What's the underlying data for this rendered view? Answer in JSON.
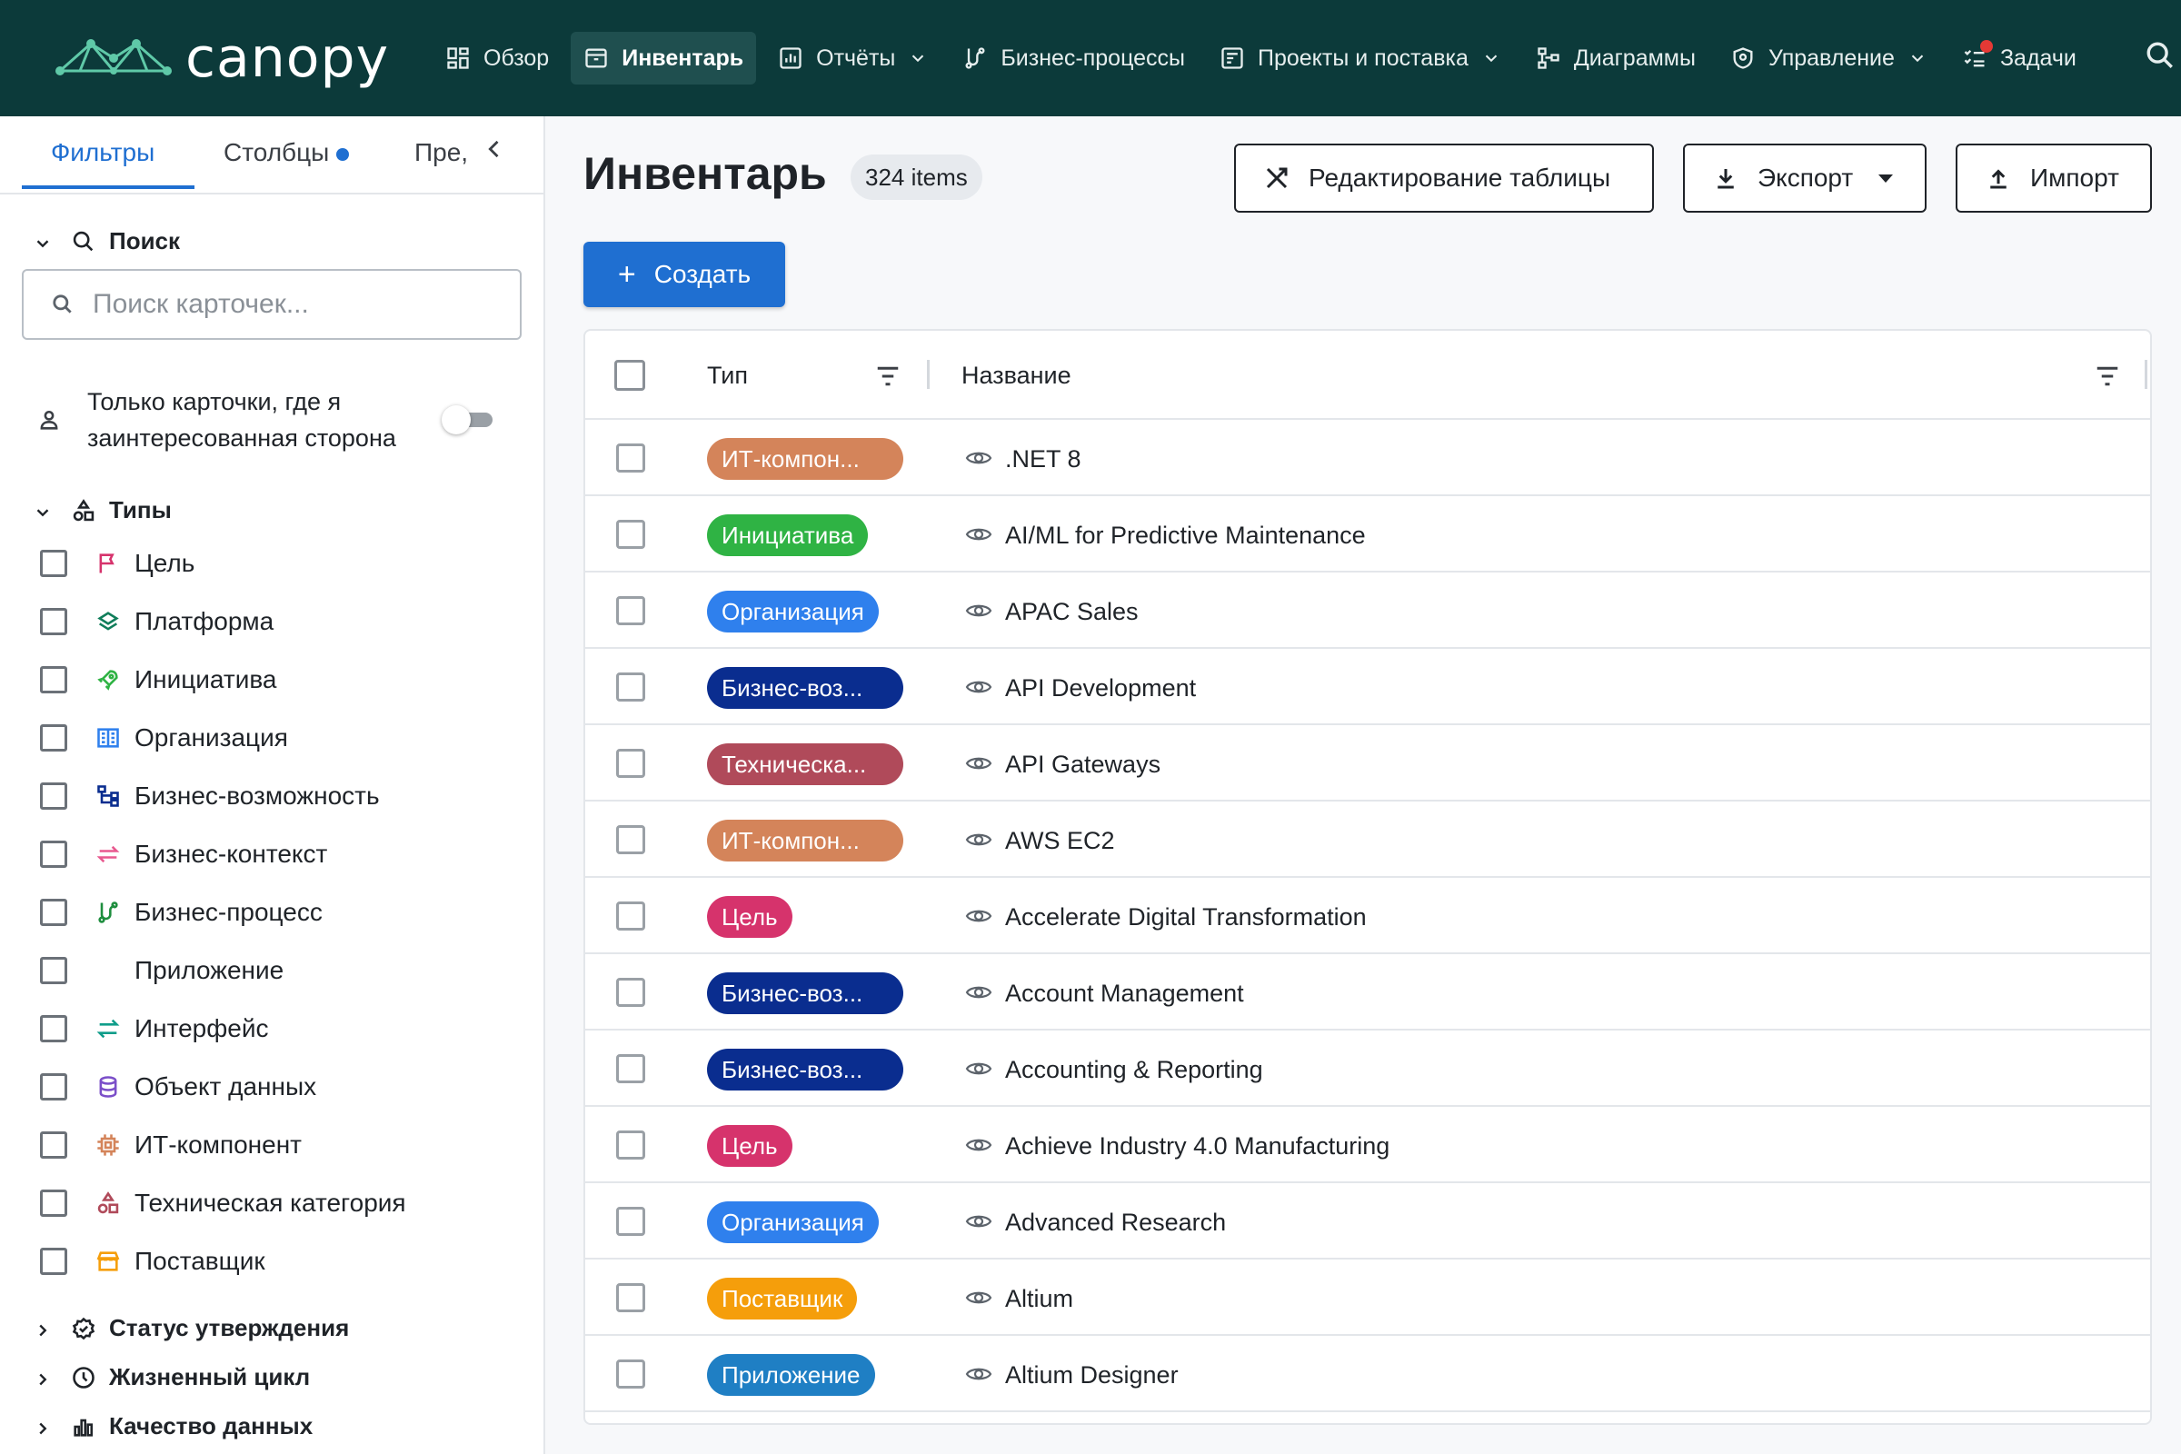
{
  "app": {
    "logo_text": "canopy"
  },
  "nav": {
    "items": [
      {
        "label": "Обзор",
        "icon": "dashboard-icon",
        "active": false,
        "dropdown": false
      },
      {
        "label": "Инвентарь",
        "icon": "inventory-icon",
        "active": true,
        "dropdown": false
      },
      {
        "label": "Отчёты",
        "icon": "reports-icon",
        "active": false,
        "dropdown": true
      },
      {
        "label": "Бизнес-процессы",
        "icon": "process-icon",
        "active": false,
        "dropdown": false
      },
      {
        "label": "Проекты и поставка",
        "icon": "projects-icon",
        "active": false,
        "dropdown": true
      },
      {
        "label": "Диаграммы",
        "icon": "diagram-icon",
        "active": false,
        "dropdown": false
      },
      {
        "label": "Управление",
        "icon": "shield-icon",
        "active": false,
        "dropdown": true
      },
      {
        "label": "Задачи",
        "icon": "tasks-icon",
        "active": false,
        "dropdown": false,
        "notification": true
      }
    ]
  },
  "sidebar": {
    "tabs": {
      "filters": "Фильтры",
      "columns": "Столбцы",
      "presets": "Пре,"
    },
    "search": {
      "title": "Поиск",
      "placeholder": "Поиск карточек..."
    },
    "stakeholder": {
      "label": "Только карточки, где я заинтересованная сторона",
      "enabled": false
    },
    "types": {
      "title": "Типы",
      "items": [
        {
          "label": "Цель",
          "icon": "flag-icon",
          "color": "#d6336c"
        },
        {
          "label": "Платформа",
          "icon": "layers-icon",
          "color": "#0f7d5a"
        },
        {
          "label": "Инициатива",
          "icon": "rocket-icon",
          "color": "#2fb344"
        },
        {
          "label": "Организация",
          "icon": "building-icon",
          "color": "#2f80ed"
        },
        {
          "label": "Бизнес-возможность",
          "icon": "hierarchy-icon",
          "color": "#0a2d8f"
        },
        {
          "label": "Бизнес-контекст",
          "icon": "arrows-exchange-icon",
          "color": "#e8598f"
        },
        {
          "label": "Бизнес-процесс",
          "icon": "process-icon",
          "color": "#1e8e3e"
        },
        {
          "label": "Приложение",
          "icon": "grid-dots-icon",
          "color": "#1f6fd1"
        },
        {
          "label": "Интерфейс",
          "icon": "swap-icon",
          "color": "#0f9d8a"
        },
        {
          "label": "Объект данных",
          "icon": "database-icon",
          "color": "#7b4fc9"
        },
        {
          "label": "ИТ-компонент",
          "icon": "chip-icon",
          "color": "#d4845a"
        },
        {
          "label": "Техническая категория",
          "icon": "shapes-icon",
          "color": "#b04a5a"
        },
        {
          "label": "Поставщик",
          "icon": "store-icon",
          "color": "#f59e0b"
        }
      ]
    },
    "sections": [
      {
        "label": "Статус утверждения",
        "icon": "badge-check-icon"
      },
      {
        "label": "Жизненный цикл",
        "icon": "clock-icon"
      },
      {
        "label": "Качество данных",
        "icon": "bar-chart-icon"
      }
    ]
  },
  "main": {
    "title": "Инвентарь",
    "count": "324 items",
    "buttons": {
      "edit_table": "Редактирование таблицы",
      "export": "Экспорт",
      "import": "Импорт",
      "create": "Создать"
    },
    "table": {
      "columns": {
        "type": "Тип",
        "name": "Название"
      },
      "rows": [
        {
          "type": "ИТ-компон...",
          "color": "#d4845a",
          "name": ".NET 8"
        },
        {
          "type": "Инициатива",
          "color": "#2fb344",
          "name": "AI/ML for Predictive Maintenance"
        },
        {
          "type": "Организация",
          "color": "#2f80ed",
          "name": "APAC Sales"
        },
        {
          "type": "Бизнес-воз...",
          "color": "#0a2d8f",
          "name": "API Development"
        },
        {
          "type": "Техническа...",
          "color": "#b04a5a",
          "name": "API Gateways"
        },
        {
          "type": "ИТ-компон...",
          "color": "#d4845a",
          "name": "AWS EC2"
        },
        {
          "type": "Цель",
          "color": "#d6336c",
          "name": "Accelerate Digital Transformation"
        },
        {
          "type": "Бизнес-воз...",
          "color": "#0a2d8f",
          "name": "Account Management"
        },
        {
          "type": "Бизнес-воз...",
          "color": "#0a2d8f",
          "name": "Accounting & Reporting"
        },
        {
          "type": "Цель",
          "color": "#d6336c",
          "name": "Achieve Industry 4.0 Manufacturing"
        },
        {
          "type": "Организация",
          "color": "#2f80ed",
          "name": "Advanced Research"
        },
        {
          "type": "Поставщик",
          "color": "#f59e0b",
          "name": "Altium"
        },
        {
          "type": "Приложение",
          "color": "#1f7fc4",
          "name": "Altium Designer"
        }
      ]
    }
  }
}
